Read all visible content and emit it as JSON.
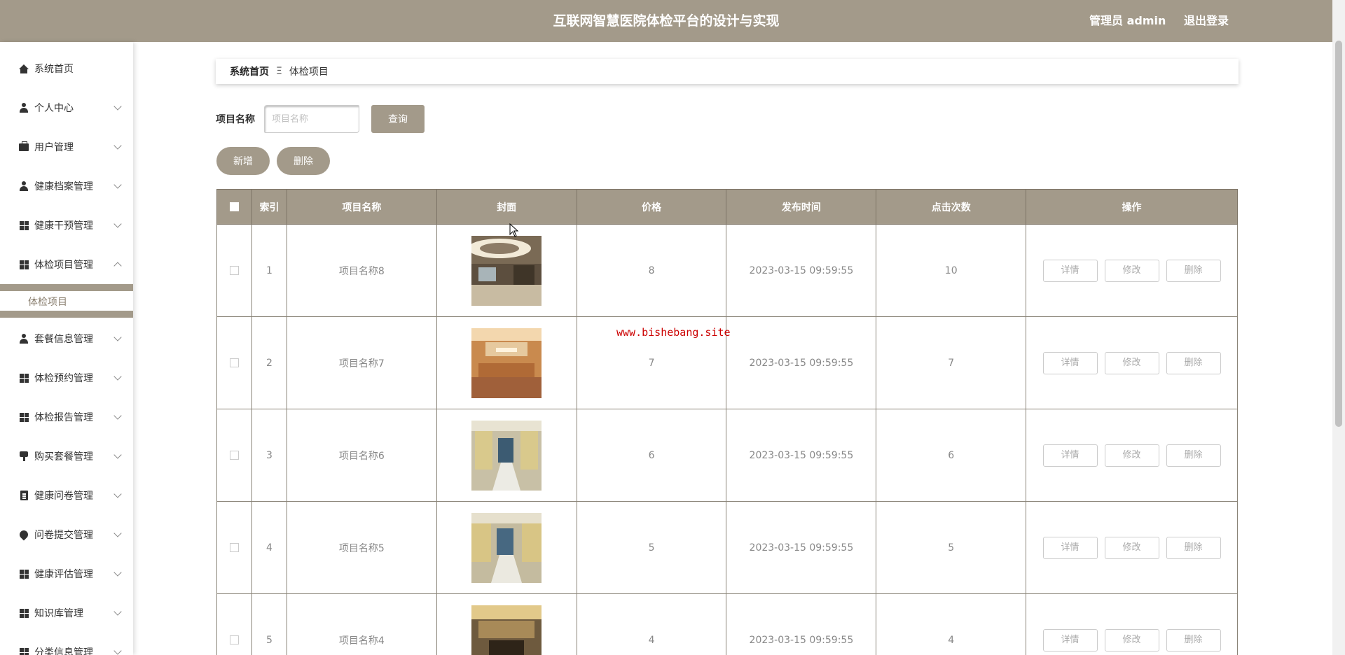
{
  "header": {
    "title": "互联网智慧医院体检平台的设计与实现",
    "user": "管理员 admin",
    "logout": "退出登录"
  },
  "sidebar": {
    "items": [
      {
        "label": "系统首页",
        "icon": "home-icon"
      },
      {
        "label": "个人中心",
        "icon": "user-icon"
      },
      {
        "label": "用户管理",
        "icon": "briefcase-icon"
      },
      {
        "label": "健康档案管理",
        "icon": "user-icon"
      },
      {
        "label": "健康干预管理",
        "icon": "grid-icon"
      },
      {
        "label": "体检项目管理",
        "icon": "grid-icon"
      },
      {
        "label": "套餐信息管理",
        "icon": "user-icon"
      },
      {
        "label": "体检预约管理",
        "icon": "grid-icon"
      },
      {
        "label": "体检报告管理",
        "icon": "grid-icon"
      },
      {
        "label": "购买套餐管理",
        "icon": "stamp-icon"
      },
      {
        "label": "健康问卷管理",
        "icon": "clipboard-icon"
      },
      {
        "label": "问卷提交管理",
        "icon": "pin-icon"
      },
      {
        "label": "健康评估管理",
        "icon": "grid-icon"
      },
      {
        "label": "知识库管理",
        "icon": "grid-icon"
      },
      {
        "label": "分类信息管理",
        "icon": "grid-icon"
      }
    ],
    "active_sub": "体检项目"
  },
  "breadcrumb": {
    "home": "系统首页",
    "sep": "Ξ",
    "current": "体检项目"
  },
  "search": {
    "label": "项目名称",
    "placeholder": "项目名称",
    "query": "查询"
  },
  "actions": {
    "add": "新增",
    "delete": "删除"
  },
  "table": {
    "headers": [
      "索引",
      "项目名称",
      "封面",
      "价格",
      "发布时间",
      "点击次数",
      "操作"
    ],
    "row_actions": [
      "详情",
      "修改",
      "删除"
    ],
    "rows": [
      {
        "index": "1",
        "name": "项目名称8",
        "price": "8",
        "time": "2023-03-15 09:59:55",
        "clicks": "10"
      },
      {
        "index": "2",
        "name": "项目名称7",
        "price": "7",
        "time": "2023-03-15 09:59:55",
        "clicks": "7"
      },
      {
        "index": "3",
        "name": "项目名称6",
        "price": "6",
        "time": "2023-03-15 09:59:55",
        "clicks": "6"
      },
      {
        "index": "4",
        "name": "项目名称5",
        "price": "5",
        "time": "2023-03-15 09:59:55",
        "clicks": "5"
      },
      {
        "index": "5",
        "name": "项目名称4",
        "price": "4",
        "time": "2023-03-15 09:59:55",
        "clicks": "4"
      }
    ]
  },
  "watermark": "www.bishebang.site",
  "colors": {
    "primary": "#a39a8a",
    "watermark": "#cc0000"
  }
}
